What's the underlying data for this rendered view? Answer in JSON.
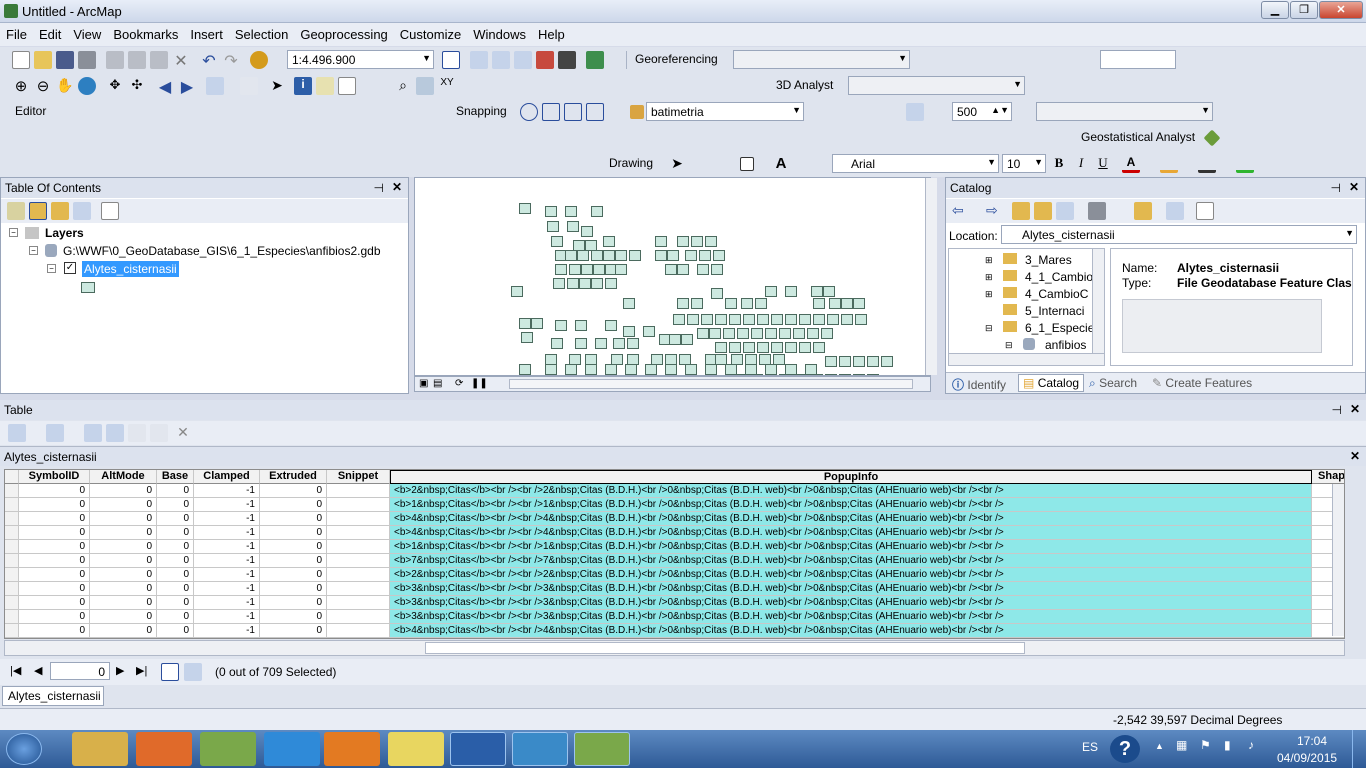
{
  "window": {
    "title": "Untitled - ArcMap",
    "min_label": "▁",
    "max_label": "❐",
    "close_label": "✕"
  },
  "menu": [
    "File",
    "Edit",
    "View",
    "Bookmarks",
    "Insert",
    "Selection",
    "Geoprocessing",
    "Customize",
    "Windows",
    "Help"
  ],
  "toolbar": {
    "scale": "1:4.496.900",
    "georeferencing_label": "Georeferencing",
    "analyst3d_label": "3D Analyst",
    "editor_label": "Editor",
    "snapping_label": "Snapping",
    "layer_select": "batimetria",
    "resolution_value": "500",
    "geostat_label": "Geostatistical Analyst",
    "drawing_label": "Drawing",
    "font_name": "Arial",
    "font_size": "10",
    "bold": "B",
    "italic": "I",
    "underline": "U",
    "text_a": "A"
  },
  "toc": {
    "title": "Table Of Contents",
    "layers_label": "Layers",
    "gdb_path": "G:\\WWF\\0_GeoDatabase_GIS\\6_1_Especies\\anfibios2.gdb",
    "layer_name": "Alytes_cisternasii"
  },
  "catalog": {
    "title": "Catalog",
    "location_label": "Location:",
    "location_value": "Alytes_cisternasii",
    "tree": [
      "3_Mares",
      "4_1_Cambio",
      "4_CambioC",
      "5_Internaci",
      "6_1_Especie",
      "anfibios"
    ],
    "name_label": "Name:",
    "name_value": "Alytes_cisternasii",
    "type_label": "Type:",
    "type_value": "File Geodatabase Feature Class",
    "tabs": [
      "Identify",
      "Catalog",
      "Search",
      "Create Features"
    ]
  },
  "table": {
    "title": "Table",
    "layer_tab": "Alytes_cisternasii",
    "columns": [
      "SymbolID",
      "AltMode",
      "Base",
      "Clamped",
      "Extruded",
      "Snippet",
      "PopupInfo",
      "Shap"
    ],
    "rows": [
      [
        "0",
        "0",
        "0",
        "-1",
        "0",
        "",
        "<b>2&nbsp;Citas</b><br /><br />2&nbsp;Citas (B.D.H.)<br />0&nbsp;Citas (B.D.H. web)<br />0&nbsp;Citas (AHEnuario web)<br /><br />"
      ],
      [
        "0",
        "0",
        "0",
        "-1",
        "0",
        "",
        "<b>1&nbsp;Citas</b><br /><br />1&nbsp;Citas (B.D.H.)<br />0&nbsp;Citas (B.D.H. web)<br />0&nbsp;Citas (AHEnuario web)<br /><br />"
      ],
      [
        "0",
        "0",
        "0",
        "-1",
        "0",
        "",
        "<b>4&nbsp;Citas</b><br /><br />4&nbsp;Citas (B.D.H.)<br />0&nbsp;Citas (B.D.H. web)<br />0&nbsp;Citas (AHEnuario web)<br /><br />"
      ],
      [
        "0",
        "0",
        "0",
        "-1",
        "0",
        "",
        "<b>4&nbsp;Citas</b><br /><br />4&nbsp;Citas (B.D.H.)<br />0&nbsp;Citas (B.D.H. web)<br />0&nbsp;Citas (AHEnuario web)<br /><br />"
      ],
      [
        "0",
        "0",
        "0",
        "-1",
        "0",
        "",
        "<b>1&nbsp;Citas</b><br /><br />1&nbsp;Citas (B.D.H.)<br />0&nbsp;Citas (B.D.H. web)<br />0&nbsp;Citas (AHEnuario web)<br /><br />"
      ],
      [
        "0",
        "0",
        "0",
        "-1",
        "0",
        "",
        "<b>7&nbsp;Citas</b><br /><br />7&nbsp;Citas (B.D.H.)<br />0&nbsp;Citas (B.D.H. web)<br />0&nbsp;Citas (AHEnuario web)<br /><br />"
      ],
      [
        "0",
        "0",
        "0",
        "-1",
        "0",
        "",
        "<b>2&nbsp;Citas</b><br /><br />2&nbsp;Citas (B.D.H.)<br />0&nbsp;Citas (B.D.H. web)<br />0&nbsp;Citas (AHEnuario web)<br /><br />"
      ],
      [
        "0",
        "0",
        "0",
        "-1",
        "0",
        "",
        "<b>3&nbsp;Citas</b><br /><br />3&nbsp;Citas (B.D.H.)<br />0&nbsp;Citas (B.D.H. web)<br />0&nbsp;Citas (AHEnuario web)<br /><br />"
      ],
      [
        "0",
        "0",
        "0",
        "-1",
        "0",
        "",
        "<b>3&nbsp;Citas</b><br /><br />3&nbsp;Citas (B.D.H.)<br />0&nbsp;Citas (B.D.H. web)<br />0&nbsp;Citas (AHEnuario web)<br /><br />"
      ],
      [
        "0",
        "0",
        "0",
        "-1",
        "0",
        "",
        "<b>3&nbsp;Citas</b><br /><br />3&nbsp;Citas (B.D.H.)<br />0&nbsp;Citas (B.D.H. web)<br />0&nbsp;Citas (AHEnuario web)<br /><br />"
      ],
      [
        "0",
        "0",
        "0",
        "-1",
        "0",
        "",
        "<b>4&nbsp;Citas</b><br /><br />4&nbsp;Citas (B.D.H.)<br />0&nbsp;Citas (B.D.H. web)<br />0&nbsp;Citas (AHEnuario web)<br /><br />"
      ]
    ],
    "record_index": "0",
    "selection_status": "(0 out of 709 Selected)"
  },
  "status": {
    "coords": "-2,542  39,597 Decimal Degrees"
  },
  "taskbar": {
    "lang": "ES",
    "time": "17:04",
    "date": "04/09/2015"
  }
}
